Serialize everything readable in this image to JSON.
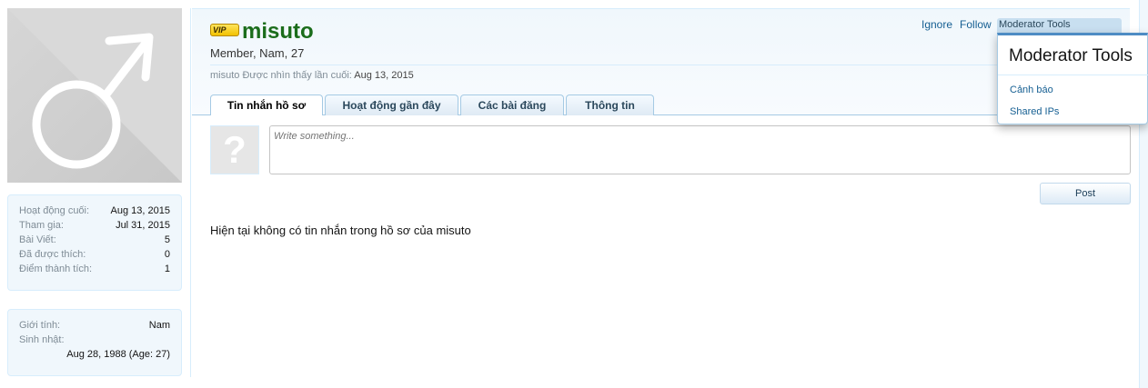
{
  "profile": {
    "vip_label": "VIP",
    "username": "misuto",
    "user_title": "Member, Nam, 27",
    "last_seen_prefix": "misuto Được nhìn thấy lần cuối:",
    "last_seen_date": "Aug 13, 2015"
  },
  "header_links": {
    "ignore": "Ignore",
    "follow": "Follow",
    "moderator_tools": "Moderator Tools"
  },
  "mod_popup": {
    "title": "Moderator Tools",
    "items": [
      "Cảnh báo",
      "Shared IPs"
    ]
  },
  "tabs": [
    "Tin nhắn hồ sơ",
    "Hoạt động gần đây",
    "Các bài đăng",
    "Thông tin"
  ],
  "composer": {
    "placeholder": "Write something...",
    "post_label": "Post"
  },
  "empty_message": "Hiện tại không có tin nhắn trong hồ sơ của misuto",
  "stats": [
    {
      "label": "Hoạt động cuối:",
      "value": "Aug 13, 2015"
    },
    {
      "label": "Tham gia:",
      "value": "Jul 31, 2015"
    },
    {
      "label": "Bài Viết:",
      "value": "5"
    },
    {
      "label": "Đã được thích:",
      "value": "0"
    },
    {
      "label": "Điểm thành tích:",
      "value": "1"
    }
  ],
  "personal": {
    "gender_label": "Giới tính:",
    "gender_value": "Nam",
    "birthday_label": "Sinh nhật:",
    "birthday_value": "Aug 28, 1988 (Age: 27)"
  }
}
